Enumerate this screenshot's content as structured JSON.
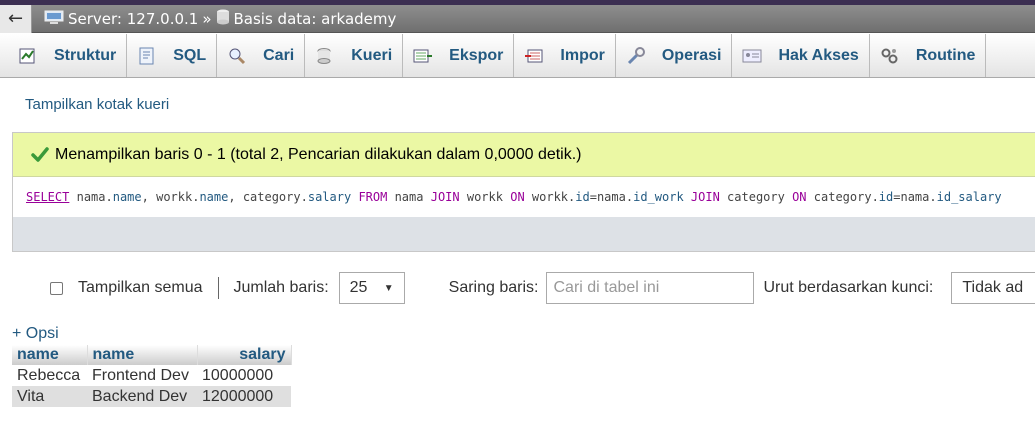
{
  "breadcrumb": {
    "back_glyph": "←",
    "server": "Server: 127.0.0.1",
    "separator": "»",
    "database": "Basis data: arkademy"
  },
  "tabs": [
    {
      "label": "Struktur",
      "icon": "structure-icon"
    },
    {
      "label": "SQL",
      "icon": "sql-icon"
    },
    {
      "label": "Cari",
      "icon": "search-icon"
    },
    {
      "label": "Kueri",
      "icon": "query-icon"
    },
    {
      "label": "Ekspor",
      "icon": "export-icon"
    },
    {
      "label": "Impor",
      "icon": "import-icon"
    },
    {
      "label": "Operasi",
      "icon": "wrench-icon"
    },
    {
      "label": "Hak Akses",
      "icon": "privileges-icon"
    },
    {
      "label": "Routine",
      "icon": "routine-icon"
    }
  ],
  "show_query_link": "Tampilkan kotak kueri",
  "success_message": "Menampilkan baris 0 - 1 (total 2, Pencarian dilakukan dalam 0,0000 detik.)",
  "sql": {
    "select": "SELECT",
    "t1": "nama",
    "c1": "name",
    "t2": "workk",
    "c2": "name",
    "t3": "category",
    "c3": "salary",
    "from": "FROM",
    "from_table": "nama",
    "join1": "JOIN",
    "join1_table": "workk",
    "on1": "ON",
    "on1_t1": "workk",
    "on1_c1": "id",
    "on1_t2": "nama",
    "on1_c2": "id_work",
    "join2": "JOIN",
    "join2_table": "category",
    "on2": "ON",
    "on2_t1": "category",
    "on2_c1": "id",
    "on2_t2": "nama",
    "on2_c2": "id_salary"
  },
  "controls": {
    "show_all_label": "Tampilkan semua",
    "row_count_label": "Jumlah baris:",
    "row_count_value": "25",
    "filter_label": "Saring baris:",
    "filter_placeholder": "Cari di tabel ini",
    "sort_label": "Urut berdasarkan kunci:",
    "sort_value": "Tidak ad"
  },
  "options_link": "+ Opsi",
  "table": {
    "headers": [
      "name",
      "name",
      "salary"
    ],
    "rows": [
      [
        "Rebecca",
        "Frontend Dev",
        "10000000"
      ],
      [
        "Vita",
        "Backend Dev",
        "12000000"
      ]
    ]
  },
  "colors": {
    "link": "#235a81",
    "success_bg": "#ebf8a4",
    "keyword": "#990099"
  }
}
